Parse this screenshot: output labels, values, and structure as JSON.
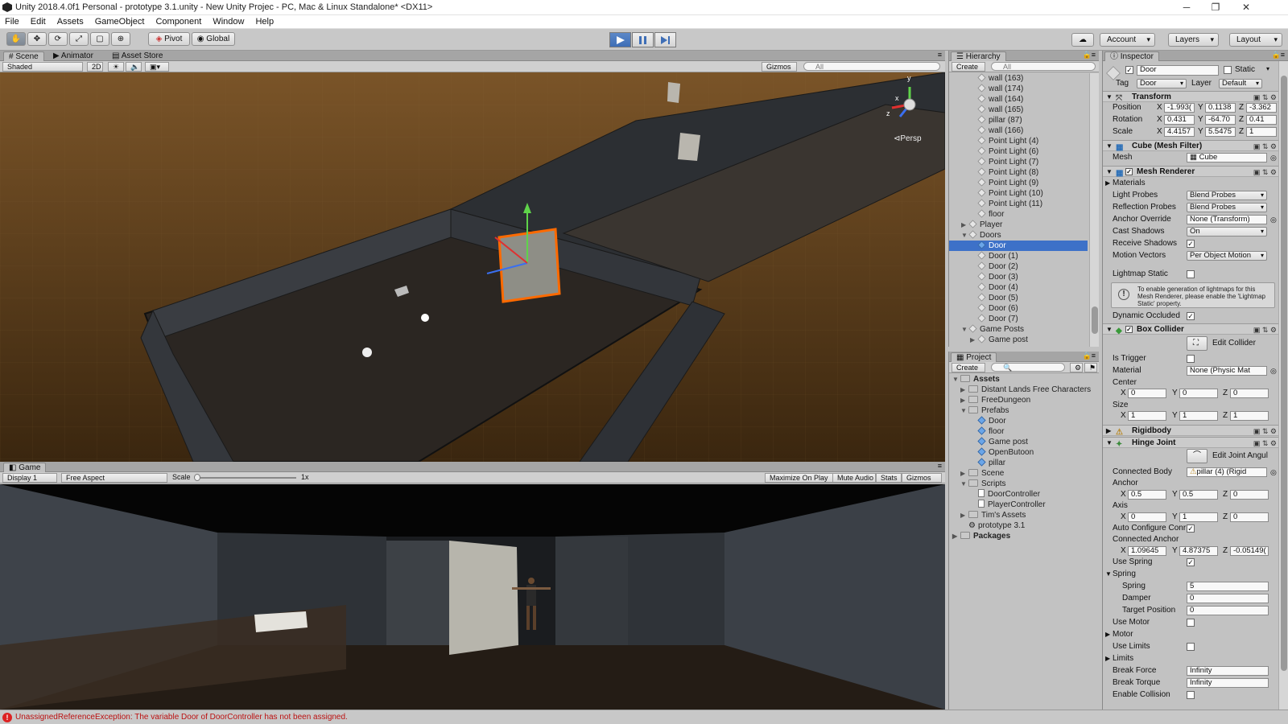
{
  "window": {
    "title": "Unity 2018.4.0f1 Personal - prototype 3.1.unity - New Unity Projec - PC, Mac & Linux Standalone* <DX11>",
    "minimize": "─",
    "restore": "❐",
    "close": "✕"
  },
  "menu": [
    "File",
    "Edit",
    "Assets",
    "GameObject",
    "Component",
    "Window",
    "Help"
  ],
  "toolbar": {
    "pivot": "Pivot",
    "global": "Global",
    "account": "Account",
    "layers": "Layers",
    "layout": "Layout"
  },
  "scene": {
    "tabs": [
      "Scene",
      "Animator",
      "Asset Store"
    ],
    "shading": "Shaded",
    "mode2d": "2D",
    "gizmos": "Gizmos",
    "search": "All",
    "persp": "Persp",
    "axis_y": "y",
    "axis_x": "x",
    "axis_z": "z"
  },
  "game": {
    "tab": "Game",
    "display": "Display 1",
    "aspect": "Free Aspect",
    "scale_label": "Scale",
    "scale_value": "1x",
    "buttons": [
      "Maximize On Play",
      "Mute Audio",
      "Stats",
      "Gizmos"
    ]
  },
  "hierarchy": {
    "tab": "Hierarchy",
    "create": "Create",
    "search": "All",
    "items": [
      "wall (163)",
      "wall (174)",
      "wall (164)",
      "wall (165)",
      "pillar (87)",
      "wall (166)",
      "Point Light (4)",
      "Point Light (6)",
      "Point Light (7)",
      "Point Light (8)",
      "Point Light (9)",
      "Point Light (10)",
      "Point Light (11)",
      "floor",
      "Player",
      "Doors",
      "Door",
      "Door (1)",
      "Door (2)",
      "Door (3)",
      "Door (4)",
      "Door (5)",
      "Door (6)",
      "Door (7)",
      "Game Posts",
      "Game post"
    ]
  },
  "project": {
    "tab": "Project",
    "create": "Create",
    "items": [
      "Assets",
      "Distant Lands Free Characters",
      "FreeDungeon",
      "Prefabs",
      "Door",
      "floor",
      "Game post",
      "OpenButoon",
      "pillar",
      "Scene",
      "Scripts",
      "DoorController",
      "PlayerController",
      "Tim's Assets",
      "prototype 3.1",
      "Packages"
    ]
  },
  "inspector": {
    "tab": "Inspector",
    "name": "Door",
    "static": "Static",
    "tag_label": "Tag",
    "tag": "Door",
    "layer_label": "Layer",
    "layer": "Default",
    "transform": {
      "title": "Transform",
      "position": "Position",
      "rotation": "Rotation",
      "scale": "Scale",
      "pos": [
        "-1.993(",
        "0.1138",
        "-3.362"
      ],
      "rot": [
        "0.431",
        "-64.70",
        "0.41"
      ],
      "scl": [
        "4.4157",
        "5.5475",
        "1"
      ]
    },
    "mesh_filter": {
      "title": "Cube (Mesh Filter)",
      "mesh_label": "Mesh",
      "mesh": "Cube"
    },
    "mesh_renderer": {
      "title": "Mesh Renderer",
      "materials": "Materials",
      "light_probes": "Light Probes",
      "light_probes_v": "Blend Probes",
      "refl_probes": "Reflection Probes",
      "refl_probes_v": "Blend Probes",
      "anchor": "Anchor Override",
      "anchor_v": "None (Transform)",
      "cast": "Cast Shadows",
      "cast_v": "On",
      "receive": "Receive Shadows",
      "motion": "Motion Vectors",
      "motion_v": "Per Object Motion",
      "lightmap": "Lightmap Static",
      "help": "To enable generation of lightmaps for this Mesh Renderer, please enable the 'Lightmap Static' property.",
      "occluded": "Dynamic Occluded"
    },
    "box_collider": {
      "title": "Box Collider",
      "edit": "Edit Collider",
      "trigger": "Is Trigger",
      "material": "Material",
      "material_v": "None (Physic Mat",
      "center": "Center",
      "center_v": [
        "0",
        "0",
        "0"
      ],
      "size": "Size",
      "size_v": [
        "1",
        "1",
        "1"
      ]
    },
    "rigidbody": {
      "title": "Rigidbody"
    },
    "hinge": {
      "title": "Hinge Joint",
      "edit": "Edit Joint Angul",
      "connected": "Connected Body",
      "connected_v": "pillar (4) (Rigid",
      "anchor": "Anchor",
      "anchor_v": [
        "0.5",
        "0.5",
        "0"
      ],
      "axis": "Axis",
      "axis_v": [
        "0",
        "1",
        "0"
      ],
      "auto": "Auto Configure Conr",
      "conn_anchor": "Connected Anchor",
      "conn_anchor_v": [
        "1.09645",
        "4.87375",
        "-0.05149("
      ],
      "use_spring": "Use Spring",
      "spring": "Spring",
      "spring_l": "Spring",
      "spring_v": "5",
      "damper": "Damper",
      "damper_v": "0",
      "target": "Target Position",
      "target_v": "0",
      "use_motor": "Use Motor",
      "motor": "Motor",
      "use_limits": "Use Limits",
      "limits": "Limits",
      "break_force": "Break Force",
      "break_force_v": "Infinity",
      "break_torque": "Break Torque",
      "break_torque_v": "Infinity",
      "enable_collision": "Enable Collision"
    }
  },
  "axes": {
    "x": "X",
    "y": "Y",
    "z": "Z"
  },
  "status": {
    "text": "UnassignedReferenceException: The variable Door of DoorController has not been assigned.",
    "icon": "!"
  }
}
